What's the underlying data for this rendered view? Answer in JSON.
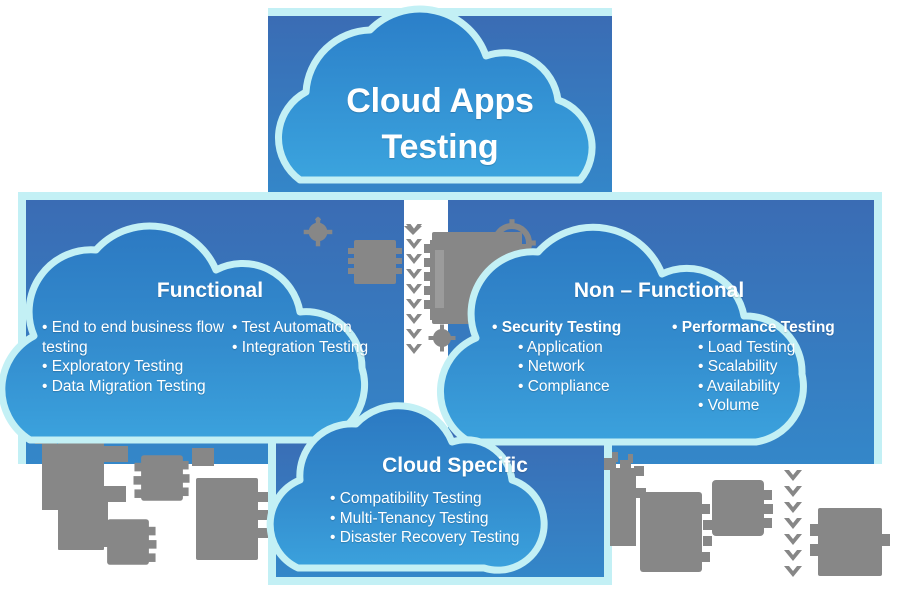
{
  "diagram": {
    "title": "Cloud Apps Testing",
    "colors": {
      "panel_blue_top": "#3a6cb4",
      "panel_blue_bottom": "#3487c9",
      "cloud_blue_top": "#2f7fc6",
      "cloud_blue_bottom": "#3a9ad9",
      "cloud_stroke": "#c3f0f5",
      "panel_border": "#c3f0f5",
      "text": "#ffffff",
      "decor_gray": "#878787"
    },
    "hero": {
      "line1": "Cloud Apps",
      "line2": "Testing"
    },
    "branches": [
      {
        "id": "functional",
        "title": "Functional",
        "columns": [
          {
            "items": [
              {
                "text": "• End to end business flow testing",
                "bold": false,
                "sub": false
              },
              {
                "text": "• Exploratory Testing",
                "bold": false,
                "sub": false
              },
              {
                "text": "• Data Migration Testing",
                "bold": false,
                "sub": false
              }
            ]
          },
          {
            "items": [
              {
                "text": "• Test Automation",
                "bold": false,
                "sub": false
              },
              {
                "text": "• Integration Testing",
                "bold": false,
                "sub": false
              }
            ]
          }
        ]
      },
      {
        "id": "non-functional",
        "title": "Non – Functional",
        "columns": [
          {
            "items": [
              {
                "text": "• Security Testing",
                "bold": true,
                "sub": false
              },
              {
                "text": "• Application",
                "bold": false,
                "sub": true
              },
              {
                "text": "• Network",
                "bold": false,
                "sub": true
              },
              {
                "text": "• Compliance",
                "bold": false,
                "sub": true
              }
            ]
          },
          {
            "items": [
              {
                "text": "• Performance Testing",
                "bold": true,
                "sub": false
              },
              {
                "text": "• Load Testing",
                "bold": false,
                "sub": true
              },
              {
                "text": "• Scalability",
                "bold": false,
                "sub": true
              },
              {
                "text": "• Availability",
                "bold": false,
                "sub": true
              },
              {
                "text": "• Volume",
                "bold": false,
                "sub": true
              }
            ]
          }
        ]
      },
      {
        "id": "cloud-specific",
        "title": "Cloud Specific",
        "columns": [
          {
            "items": [
              {
                "text": "• Compatibility Testing",
                "bold": false,
                "sub": false
              },
              {
                "text": "• Multi-Tenancy Testing",
                "bold": false,
                "sub": false
              },
              {
                "text": "• Disaster Recovery Testing",
                "bold": false,
                "sub": false
              }
            ]
          }
        ]
      }
    ],
    "decorations": {
      "gear_icon": "gear-icon",
      "chevron_icon": "chevron-down-icon",
      "server_icon": "server-icon"
    }
  }
}
